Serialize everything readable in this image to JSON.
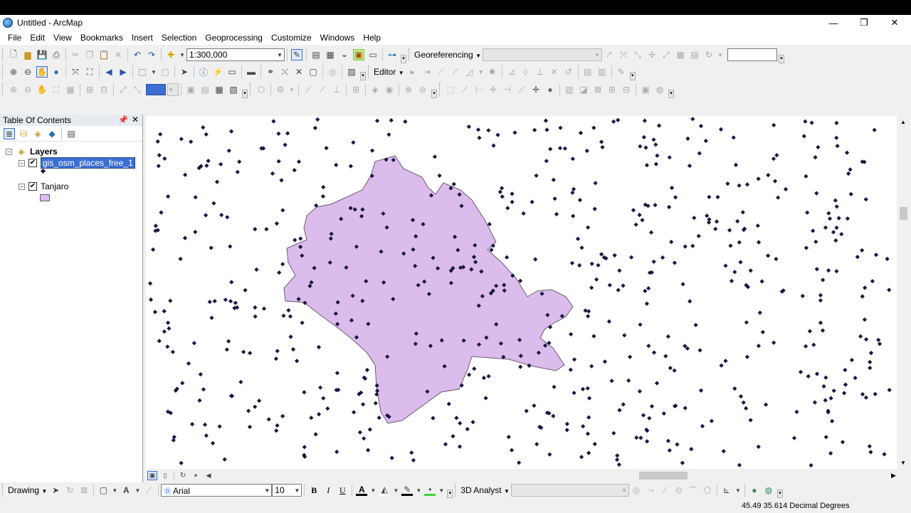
{
  "window": {
    "title": "Untitled - ArcMap",
    "controls": [
      "—",
      "❐",
      "✕"
    ]
  },
  "menu": [
    "File",
    "Edit",
    "View",
    "Bookmarks",
    "Insert",
    "Selection",
    "Geoprocessing",
    "Customize",
    "Windows",
    "Help"
  ],
  "toolbar": {
    "scale_value": "1:300,000",
    "georeferencing_label": "Georeferencing",
    "editor_label": "Editor",
    "drawing_label": "Drawing",
    "font_name": "Arial",
    "font_size": "10",
    "analyst_label": "3D Analyst",
    "bold_label": "B",
    "italic_label": "I",
    "underline_label": "U",
    "font_color_label": "A"
  },
  "toc": {
    "header": "Table Of Contents",
    "group": "Layers",
    "layers": [
      {
        "name": "gis_osm_places_free_1",
        "checked": true,
        "selected": true,
        "symbol": "point"
      },
      {
        "name": "Tanjaro",
        "checked": true,
        "selected": false,
        "symbol": "polygon"
      }
    ]
  },
  "map": {
    "point_color": "#141640",
    "polygon_fill": "#dcbcec",
    "polygon_stroke": "#6b5a72"
  },
  "status": {
    "coordinates": "45.49  35.614 Decimal Degrees"
  },
  "colors": {
    "accent_selection": "#3b6fd3",
    "toc_header": "#e6ebf2"
  },
  "icons": [
    "new-document-icon",
    "open-icon",
    "save-icon",
    "print-icon",
    "cut-icon",
    "copy-icon",
    "paste-icon",
    "delete-icon",
    "undo-icon",
    "redo-icon",
    "add-data-icon",
    "zoom-in-icon",
    "zoom-out-icon",
    "pan-icon",
    "full-extent-icon",
    "back-icon",
    "forward-icon",
    "select-icon",
    "identify-icon",
    "find-icon",
    "globe-icon"
  ]
}
